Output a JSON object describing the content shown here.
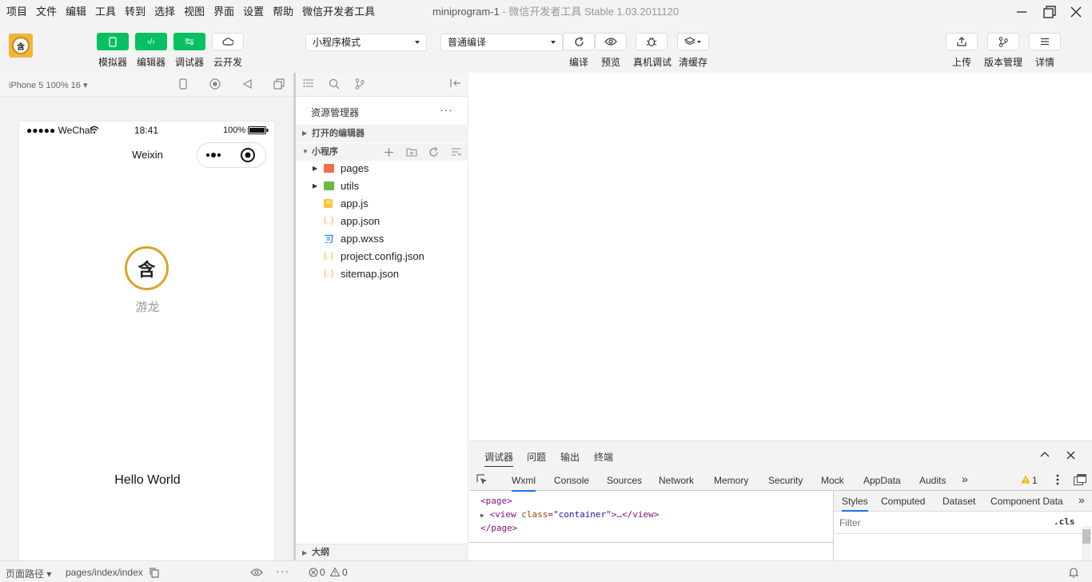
{
  "menu": [
    "项目",
    "文件",
    "编辑",
    "工具",
    "转到",
    "选择",
    "视图",
    "界面",
    "设置",
    "帮助",
    "微信开发者工具"
  ],
  "window": {
    "title": "miniprogram-1",
    "subtitle": " - 微信开发者工具 Stable 1.03.2011120"
  },
  "toolbar": {
    "logo_text": "含",
    "left_buttons": [
      {
        "label": "模拟器",
        "icon": "phone-icon"
      },
      {
        "label": "编辑器",
        "icon": "code-icon"
      },
      {
        "label": "调试器",
        "icon": "debug-icon"
      },
      {
        "label": "云开发",
        "icon": "cloud-icon"
      }
    ],
    "mode_select": "小程序模式",
    "compile_select": "普通编译",
    "mid_buttons": [
      {
        "label": "编译",
        "icon": "refresh-icon"
      },
      {
        "label": "预览",
        "icon": "eye-icon"
      },
      {
        "label": "真机调试",
        "icon": "bug-icon"
      },
      {
        "label": "清缓存",
        "icon": "layers-icon"
      }
    ],
    "right_buttons": [
      {
        "label": "上传",
        "icon": "upload-icon"
      },
      {
        "label": "版本管理",
        "icon": "branch-icon"
      },
      {
        "label": "详情",
        "icon": "menu-icon"
      }
    ]
  },
  "simulator": {
    "device": "iPhone 5 100% 16 ▾",
    "carrier": "●●●●● WeChat",
    "time": "18:41",
    "battery": "100%",
    "nav_title": "Weixin",
    "avatar_text": "含",
    "nickname": "游龙",
    "hello": "Hello World"
  },
  "explorer": {
    "title": "资源管理器",
    "more": "···",
    "open_editors": "打开的编辑器",
    "project": "小程序",
    "files": [
      {
        "name": "pages",
        "type": "folder",
        "color": "#f26d4f"
      },
      {
        "name": "utils",
        "type": "folder",
        "color": "#6bb84a"
      },
      {
        "name": "app.js",
        "type": "js",
        "color": "#f4c53a"
      },
      {
        "name": "app.json",
        "type": "json",
        "color": "#e8b535"
      },
      {
        "name": "app.wxss",
        "type": "css",
        "color": "#3d8fe0"
      },
      {
        "name": "project.config.json",
        "type": "json",
        "color": "#e8b535"
      },
      {
        "name": "sitemap.json",
        "type": "json",
        "color": "#e8b535"
      }
    ],
    "outline": "大纲"
  },
  "devtools": {
    "top_tabs": [
      "调试器",
      "问题",
      "输出",
      "终端"
    ],
    "panel_tabs": [
      "Wxml",
      "Console",
      "Sources",
      "Network",
      "Memory",
      "Security",
      "Mock",
      "AppData",
      "Audits",
      "»"
    ],
    "warning_count": "1",
    "code": {
      "line1": "<page>",
      "line2_tag_open": "<view ",
      "line2_attr": "class",
      "line2_eq": "=",
      "line2_val": "\"container\"",
      "line2_rest": ">…</view>",
      "line3": "</page>"
    },
    "side_tabs": [
      "Styles",
      "Computed",
      "Dataset",
      "Component Data",
      "»"
    ],
    "filter_placeholder": "Filter",
    "cls": ".cls"
  },
  "statusbar": {
    "path_label": "页面路径 ▾",
    "path": "pages/index/index",
    "errors": "0",
    "warnings": "0"
  }
}
